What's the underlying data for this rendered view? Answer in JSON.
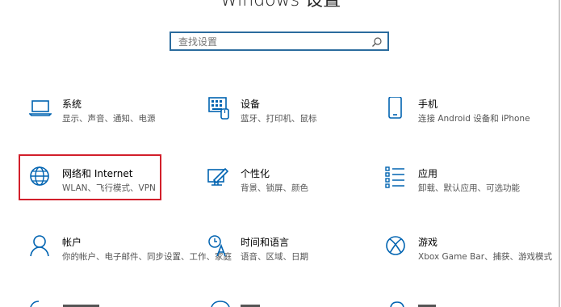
{
  "header": {
    "title": "Windows 设置"
  },
  "search": {
    "placeholder": "查找设置",
    "icon": "search-icon"
  },
  "tiles": [
    {
      "title": "系统",
      "desc": "显示、声音、通知、电源",
      "icon": "laptop-icon"
    },
    {
      "title": "设备",
      "desc": "蓝牙、打印机、鼠标",
      "icon": "keyboard-icon"
    },
    {
      "title": "手机",
      "desc": "连接 Android 设备和 iPhone",
      "icon": "phone-icon"
    },
    {
      "title": "网络和 Internet",
      "desc": "WLAN、飞行模式、VPN",
      "icon": "globe-icon",
      "selected": true
    },
    {
      "title": "个性化",
      "desc": "背景、锁屏、颜色",
      "icon": "paint-icon"
    },
    {
      "title": "应用",
      "desc": "卸载、默认应用、可选功能",
      "icon": "apps-icon"
    },
    {
      "title": "帐户",
      "desc": "你的帐户、电子邮件、同步设置、工作、家庭",
      "icon": "person-icon"
    },
    {
      "title": "时间和语言",
      "desc": "语音、区域、日期",
      "icon": "time-language-icon"
    },
    {
      "title": "游戏",
      "desc": "Xbox Game Bar、捕获、游戏模式",
      "icon": "xbox-icon"
    }
  ],
  "colors": {
    "accent": "#0063b1",
    "selection_border": "#d21f2b",
    "search_border": "#2b6c9e"
  }
}
